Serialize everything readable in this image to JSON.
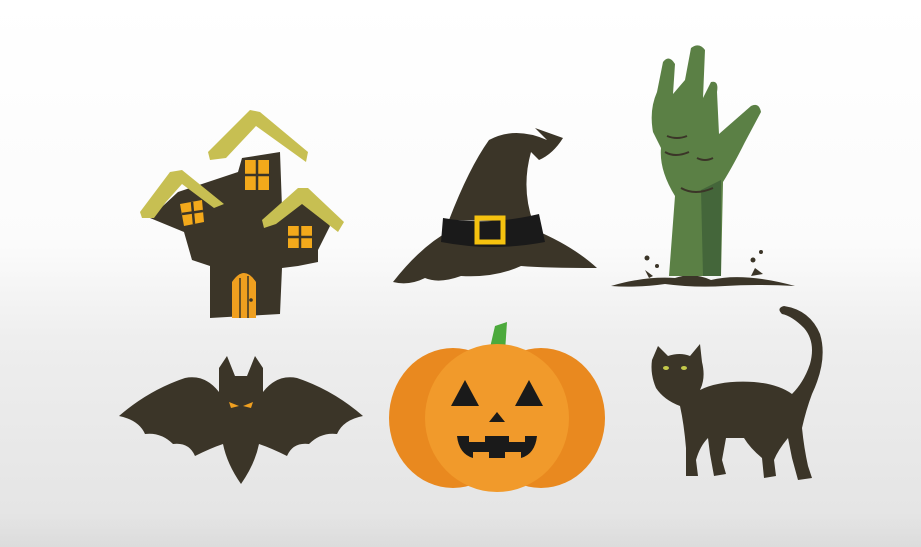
{
  "colors": {
    "background_top": "#ffffff",
    "background_bottom": "#e3e3e3",
    "dark_brown": "#3b3528",
    "roof_olive": "#c7bf52",
    "window_yellow": "#f3a91b",
    "door_orange": "#ef9f1f",
    "hat_band": "#1a1a1a",
    "buckle_yellow": "#f5c20f",
    "zombie_green": "#5b8045",
    "zombie_shade": "#44663a",
    "pumpkin_orange": "#e9891f",
    "pumpkin_light": "#f19a2b",
    "stem_green": "#4caa3c",
    "bat_eye": "#f0a020",
    "cat_eye": "#c4c94a"
  },
  "icons": [
    {
      "id": "haunted-house",
      "icon": "haunted-house-icon"
    },
    {
      "id": "witch-hat",
      "icon": "witch-hat-icon"
    },
    {
      "id": "zombie-hand",
      "icon": "zombie-hand-icon"
    },
    {
      "id": "bat",
      "icon": "bat-icon"
    },
    {
      "id": "pumpkin",
      "icon": "jack-o-lantern-icon"
    },
    {
      "id": "black-cat",
      "icon": "black-cat-icon"
    }
  ]
}
